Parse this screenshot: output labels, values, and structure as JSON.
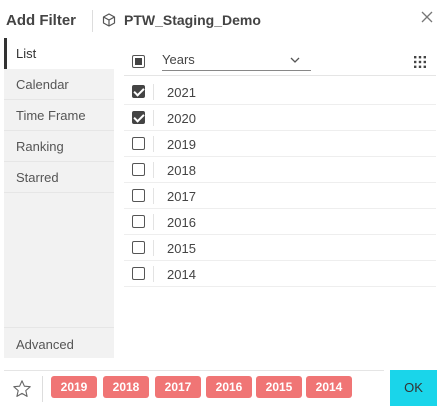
{
  "header": {
    "title": "Add Filter",
    "dataset": "PTW_Staging_Demo"
  },
  "sidebar": {
    "items": [
      {
        "label": "List",
        "active": true
      },
      {
        "label": "Calendar",
        "active": false
      },
      {
        "label": "Time Frame",
        "active": false
      },
      {
        "label": "Ranking",
        "active": false
      },
      {
        "label": "Starred",
        "active": false
      }
    ],
    "advanced_label": "Advanced"
  },
  "list": {
    "field_select": "Years",
    "rows": [
      {
        "label": "2021",
        "checked": true
      },
      {
        "label": "2020",
        "checked": true
      },
      {
        "label": "2019",
        "checked": false
      },
      {
        "label": "2018",
        "checked": false
      },
      {
        "label": "2017",
        "checked": false
      },
      {
        "label": "2016",
        "checked": false
      },
      {
        "label": "2015",
        "checked": false
      },
      {
        "label": "2014",
        "checked": false
      }
    ]
  },
  "footer": {
    "chips": [
      "2019",
      "2018",
      "2017",
      "2016",
      "2015",
      "2014"
    ],
    "ok_label": "OK"
  },
  "colors": {
    "chip": "#f07575",
    "ok_button": "#1ad5ea",
    "sidebar_bg": "#f2f2f2"
  },
  "icons": [
    "cube-icon",
    "close-icon",
    "chevron-down-icon",
    "grid-icon",
    "star-icon"
  ]
}
